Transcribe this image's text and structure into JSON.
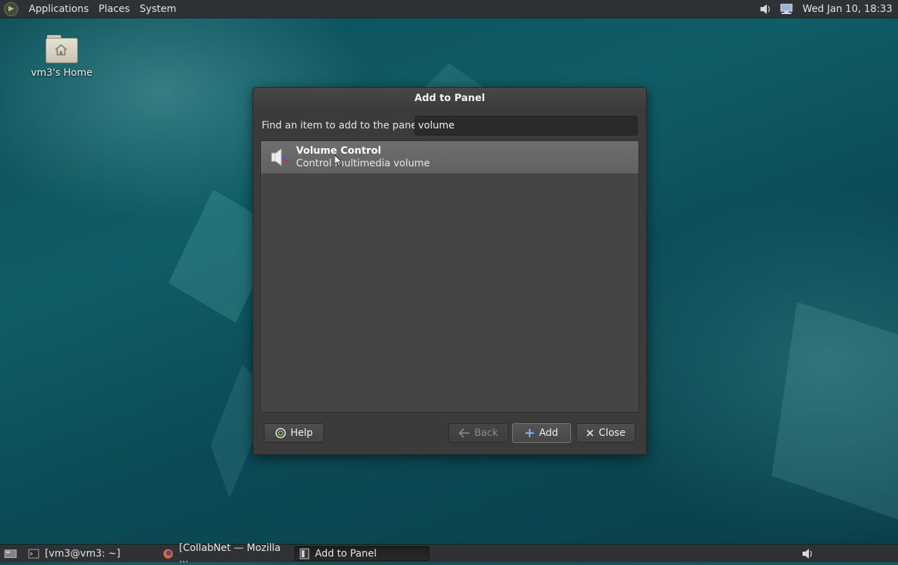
{
  "top_panel": {
    "menus": [
      "Applications",
      "Places",
      "System"
    ],
    "clock": "Wed Jan 10, 18:33",
    "tray_icons": [
      "volume-icon",
      "network-icon"
    ]
  },
  "desktop": {
    "icons": [
      {
        "label": "vm3's Home",
        "icon": "home-folder-icon"
      }
    ]
  },
  "dialog": {
    "title": "Add to Panel",
    "find_label": "Find an item to add to the panel:",
    "search_value": "volume",
    "results": [
      {
        "title": "Volume Control",
        "description": "Control multimedia volume",
        "icon": "volume-control-icon",
        "selected": true
      }
    ],
    "buttons": {
      "help": "Help",
      "back": "Back",
      "add": "Add",
      "close": "Close"
    }
  },
  "taskbar": {
    "tasks": [
      {
        "label": "[vm3@vm3: ~]",
        "icon": "terminal-icon",
        "active": false
      },
      {
        "label": "[CollabNet — Mozilla ...",
        "icon": "firefox-icon",
        "active": false
      },
      {
        "label": "Add to Panel",
        "icon": "window-icon",
        "active": true
      }
    ]
  },
  "colors": {
    "desktop_bg": "#0f5d66",
    "panel_bg": "#2f3234",
    "dialog_bg": "#3b3b3b",
    "selection_bg": "#6e6e6e"
  }
}
